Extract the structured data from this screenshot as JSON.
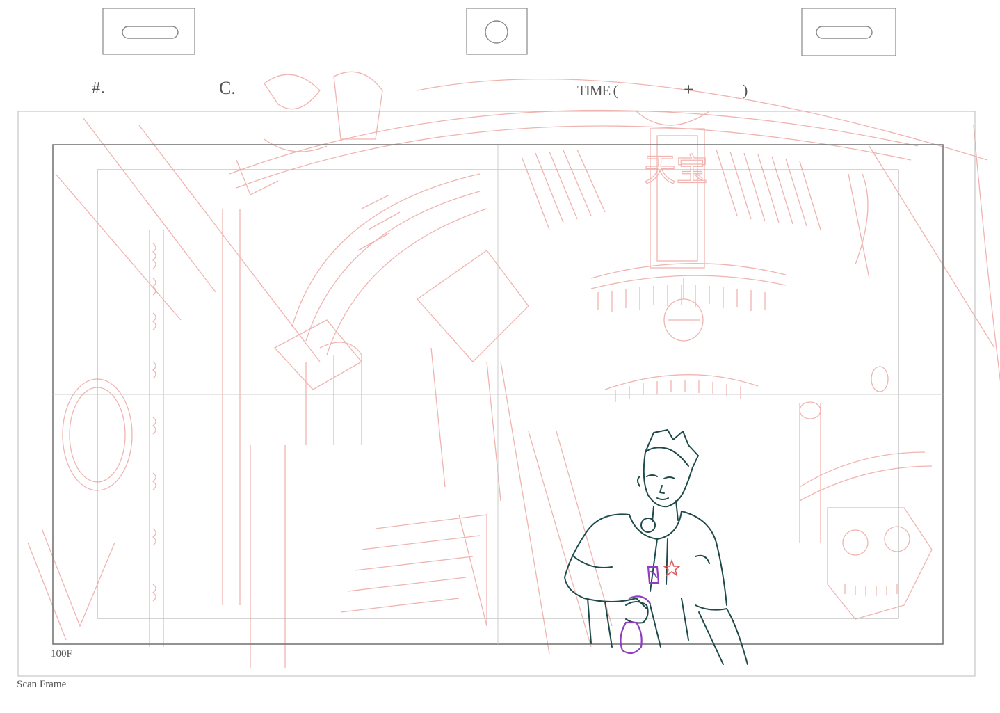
{
  "sheet": {
    "hash_label": "#.",
    "cut_label": "C.",
    "time_label": "TIME (",
    "time_plus": "+",
    "time_close": ")",
    "frame_size_label": "100F",
    "scan_frame_label": "Scan Frame",
    "sign_text": "天宝"
  },
  "colors": {
    "background": "#ffffff",
    "frame_line": "#888888",
    "layout_line": "#f0b4b0",
    "character_line": "#1f4a4a",
    "character_accent": "#8e3fbf",
    "star_accent": "#e05a5a"
  },
  "icons": {
    "left_peg": "slot-peg-icon",
    "center_peg": "round-peg-icon",
    "right_peg": "slot-peg-icon"
  }
}
